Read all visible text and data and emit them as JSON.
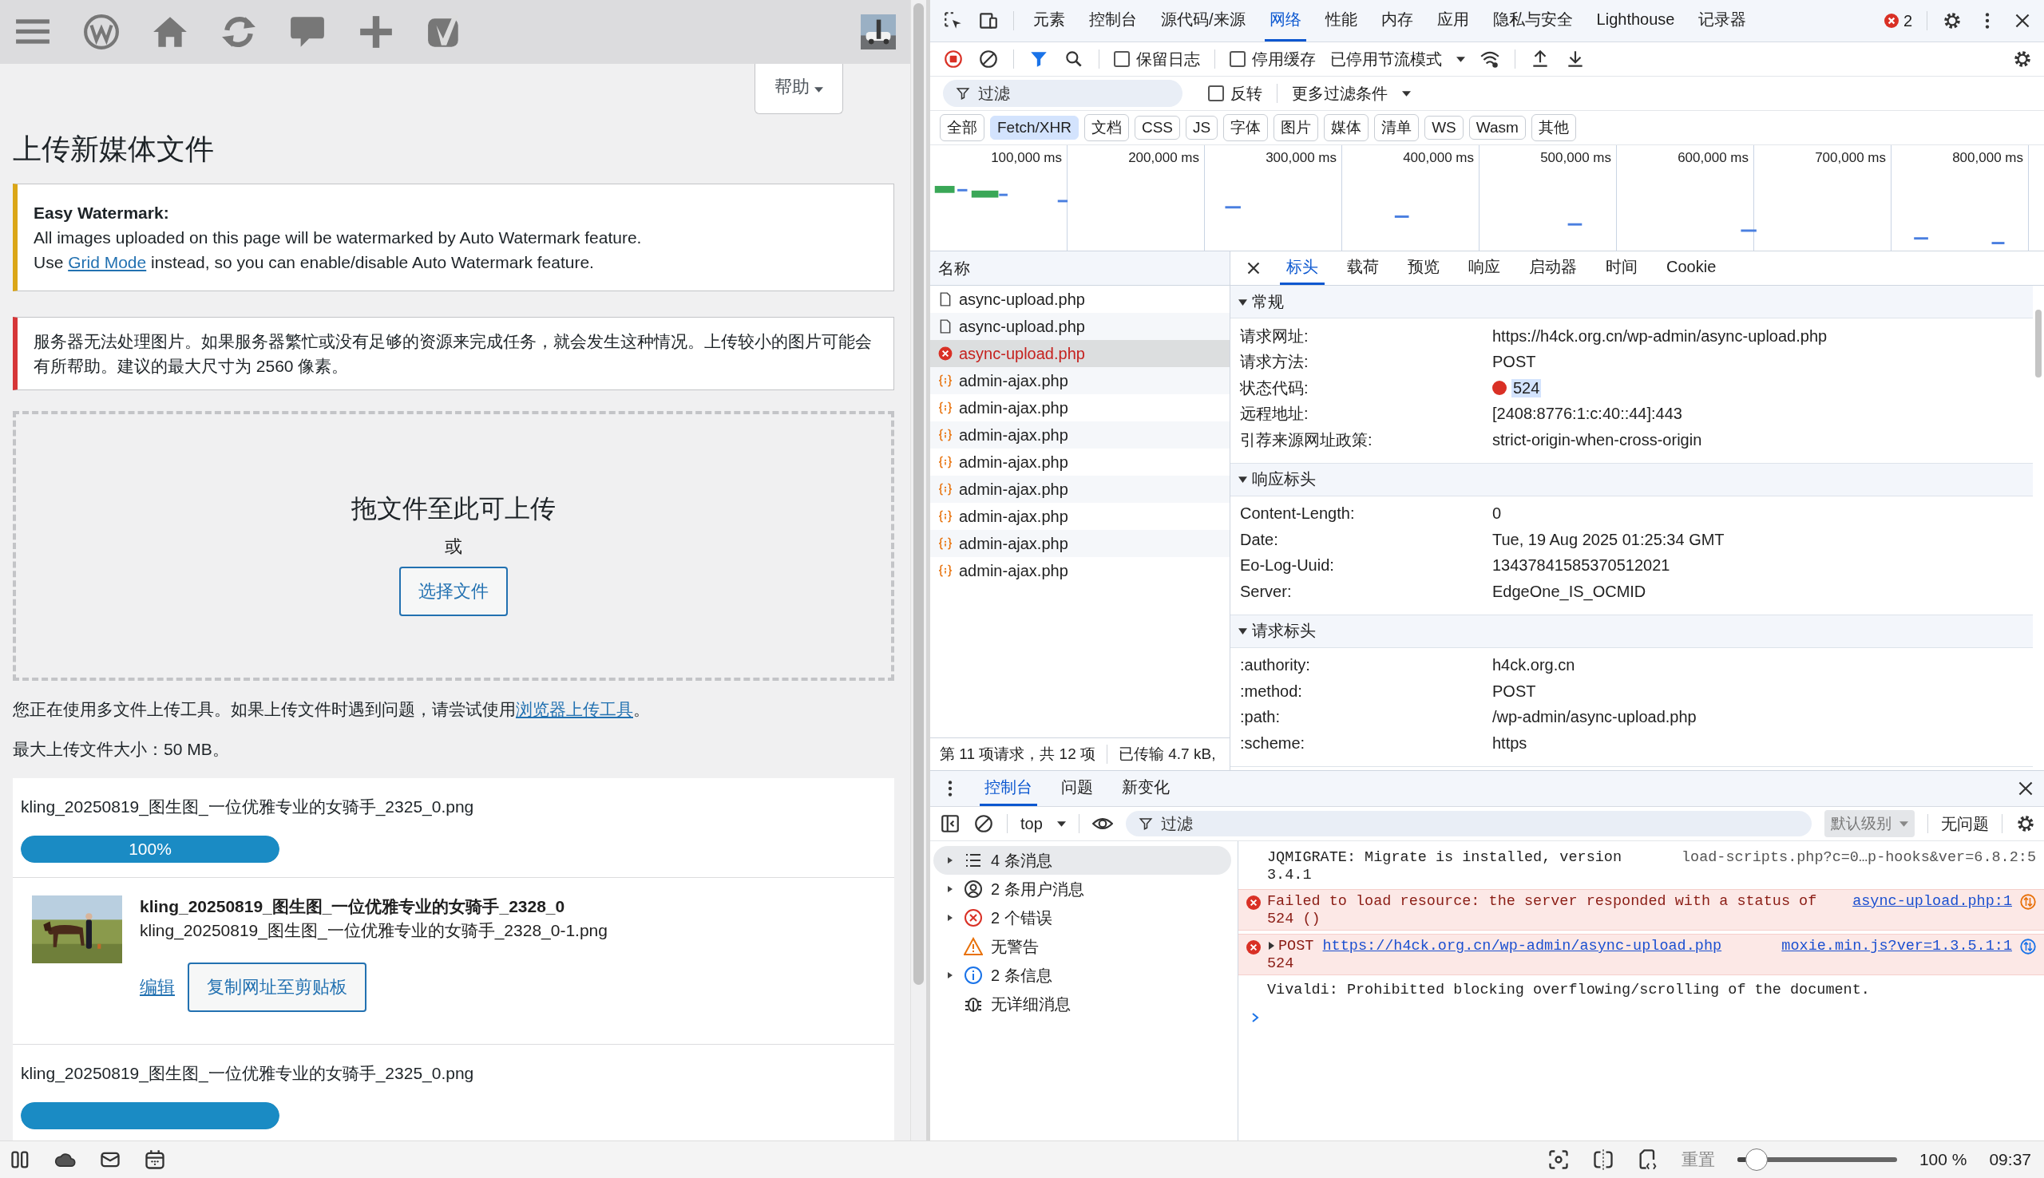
{
  "wp": {
    "help_button": "帮助",
    "page_title": "上传新媒体文件",
    "notices": [
      {
        "kind": "warning",
        "title": "Easy Watermark:",
        "lines": [
          {
            "before": "All images uploaded on this page will be watermarked by Auto Watermark feature."
          },
          {
            "before": "Use ",
            "link": "Grid Mode",
            "after": " instead, so you can enable/disable Auto Watermark feature."
          }
        ]
      },
      {
        "kind": "error",
        "lines": [
          {
            "before": "服务器无法处理图片。如果服务器繁忙或没有足够的资源来完成任务，就会发生这种情况。上传较小的图片可能会有所帮助。建议的最大尺寸为 2560 像素。"
          }
        ]
      }
    ],
    "dropzone": {
      "title": "拖文件至此可上传",
      "or": "或",
      "button": "选择文件"
    },
    "info": {
      "before": "您正在使用多文件上传工具。如果上传文件时遇到问题，请尝试使用",
      "link": "浏览器上传工具",
      "after": "。"
    },
    "max_size": "最大上传文件大小：50 MB。",
    "uploads": [
      {
        "kind": "progress",
        "filename": "kling_20250819_图生图_一位优雅专业的女骑手_2325_0.png",
        "level": 1,
        "reading": "100%"
      },
      {
        "kind": "done",
        "title": "kling_20250819_图生图_一位优雅专业的女骑手_2328_0",
        "filename": "kling_20250819_图生图_一位优雅专业的女骑手_2328_0-1.png",
        "edit": "编辑",
        "copy": "复制网址至剪贴板"
      },
      {
        "kind": "progress",
        "filename": "kling_20250819_图生图_一位优雅专业的女骑手_2325_0.png",
        "level": 1
      }
    ]
  },
  "devtools": {
    "tabs": [
      {
        "label": "元素",
        "selected": false
      },
      {
        "label": "控制台",
        "selected": false
      },
      {
        "label": "源代码/来源",
        "selected": false
      },
      {
        "label": "网络",
        "selected": true
      },
      {
        "label": "性能",
        "selected": false
      },
      {
        "label": "内存",
        "selected": false
      },
      {
        "label": "应用",
        "selected": false
      },
      {
        "label": "隐私与安全",
        "selected": false
      },
      {
        "label": "Lighthouse",
        "selected": false
      },
      {
        "label": "记录器",
        "selected": false
      }
    ],
    "error_count": "2",
    "toolbar": {
      "preserve_log": {
        "label": "保留日志",
        "checked": false
      },
      "disable_cache": {
        "label": "停用缓存",
        "checked": false
      },
      "throttling": "已停用节流模式"
    },
    "filter": {
      "placeholder": "过滤",
      "invert": {
        "label": "反转",
        "checked": false
      },
      "more_filters": "更多过滤条件"
    },
    "type_filters": [
      {
        "label": "全部",
        "selected": false
      },
      {
        "label": "Fetch/XHR",
        "selected": true
      },
      {
        "label": "文档",
        "selected": false
      },
      {
        "label": "CSS",
        "selected": false
      },
      {
        "label": "JS",
        "selected": false
      },
      {
        "label": "字体",
        "selected": false
      },
      {
        "label": "图片",
        "selected": false
      },
      {
        "label": "媒体",
        "selected": false
      },
      {
        "label": "清单",
        "selected": false
      },
      {
        "label": "WS",
        "selected": false
      },
      {
        "label": "Wasm",
        "selected": false
      },
      {
        "label": "其他",
        "selected": false
      }
    ],
    "timeline_ticks": [
      "100,000 ms",
      "200,000 ms",
      "300,000 ms",
      "400,000 ms",
      "500,000 ms",
      "600,000 ms",
      "700,000 ms",
      "800,000 ms"
    ],
    "requests_header": "名称",
    "requests": [
      {
        "name": "async-upload.php",
        "kind": "document",
        "selected": false
      },
      {
        "name": "async-upload.php",
        "kind": "document",
        "selected": false
      },
      {
        "name": "async-upload.php",
        "kind": "error",
        "selected": true
      },
      {
        "name": "admin-ajax.php",
        "kind": "xhr",
        "selected": false
      },
      {
        "name": "admin-ajax.php",
        "kind": "xhr",
        "selected": false
      },
      {
        "name": "admin-ajax.php",
        "kind": "xhr",
        "selected": false
      },
      {
        "name": "admin-ajax.php",
        "kind": "xhr",
        "selected": false
      },
      {
        "name": "admin-ajax.php",
        "kind": "xhr",
        "selected": false
      },
      {
        "name": "admin-ajax.php",
        "kind": "xhr",
        "selected": false
      },
      {
        "name": "admin-ajax.php",
        "kind": "xhr",
        "selected": false
      },
      {
        "name": "admin-ajax.php",
        "kind": "xhr",
        "selected": false
      }
    ],
    "requests_status": [
      "第 11 项请求，共 12 项",
      "已传输 4.7 kB,"
    ],
    "detail_tabs": [
      {
        "label": "标头",
        "selected": true
      },
      {
        "label": "载荷",
        "selected": false
      },
      {
        "label": "预览",
        "selected": false
      },
      {
        "label": "响应",
        "selected": false
      },
      {
        "label": "启动器",
        "selected": false
      },
      {
        "label": "时间",
        "selected": false
      },
      {
        "label": "Cookie",
        "selected": false
      }
    ],
    "sections": [
      {
        "title": "常规",
        "expanded": true,
        "rows": [
          {
            "key": "请求网址:",
            "value": "https://h4ck.org.cn/wp-admin/async-upload.php"
          },
          {
            "key": "请求方法:",
            "value": "POST"
          },
          {
            "key": "状态代码:",
            "value": "524",
            "kind": "status",
            "color": "#d93025"
          },
          {
            "key": "远程地址:",
            "value": "[2408:8776:1:c:40::44]:443"
          },
          {
            "key": "引荐来源网址政策:",
            "value": "strict-origin-when-cross-origin"
          }
        ]
      },
      {
        "title": "响应标头",
        "expanded": true,
        "rows": [
          {
            "key": "Content-Length:",
            "value": "0"
          },
          {
            "key": "Date:",
            "value": "Tue, 19 Aug 2025 01:25:34 GMT"
          },
          {
            "key": "Eo-Log-Uuid:",
            "value": "13437841585370512021"
          },
          {
            "key": "Server:",
            "value": "EdgeOne_IS_OCMID"
          }
        ]
      },
      {
        "title": "请求标头",
        "expanded": true,
        "rows": [
          {
            "key": ":authority:",
            "value": "h4ck.org.cn"
          },
          {
            "key": ":method:",
            "value": "POST"
          },
          {
            "key": ":path:",
            "value": "/wp-admin/async-upload.php"
          },
          {
            "key": ":scheme:",
            "value": "https"
          }
        ]
      }
    ],
    "drawer_tabs": [
      {
        "label": "控制台",
        "selected": true
      },
      {
        "label": "问题",
        "selected": false
      },
      {
        "label": "新变化",
        "selected": false
      }
    ],
    "console": {
      "context": "top",
      "filter_placeholder": "过滤",
      "levels": "默认级别",
      "issues": "无问题",
      "sidebar": [
        {
          "label": "4 条消息",
          "kind": "messages",
          "expandable": true,
          "selected": true
        },
        {
          "label": "2 条用户消息",
          "kind": "user",
          "expandable": true,
          "selected": false
        },
        {
          "label": "2 个错误",
          "kind": "errors",
          "expandable": true,
          "selected": false
        },
        {
          "label": "无警告",
          "kind": "warnings",
          "expandable": false,
          "selected": false
        },
        {
          "label": "2 条信息",
          "kind": "info",
          "expandable": true,
          "selected": false
        },
        {
          "label": "无详细消息",
          "kind": "verbose",
          "expandable": false,
          "selected": false
        }
      ],
      "messages": [
        {
          "kind": "log",
          "text": "JQMIGRATE: Migrate is installed, version 3.4.1",
          "source": "load-scripts.php?c=0…p-hooks&ver=6.8.2:5"
        },
        {
          "kind": "error",
          "text": "Failed to load resource: the server responded with a status of 524 ()",
          "source": "async-upload.php:1"
        },
        {
          "kind": "error",
          "method": "POST",
          "url": "https://h4ck.org.cn/wp-admin/async-upload.php",
          "text": "524",
          "source": "moxie.min.js?ver=1.3.5.1:1"
        },
        {
          "kind": "log",
          "text": "Vivaldi: Prohibitted blocking overflowing/scrolling of the document."
        }
      ]
    }
  },
  "status_bar": {
    "reset": "重置",
    "zoom": {
      "level": 0.12
    },
    "zoom_reading": "100 %",
    "time": "09:37"
  }
}
